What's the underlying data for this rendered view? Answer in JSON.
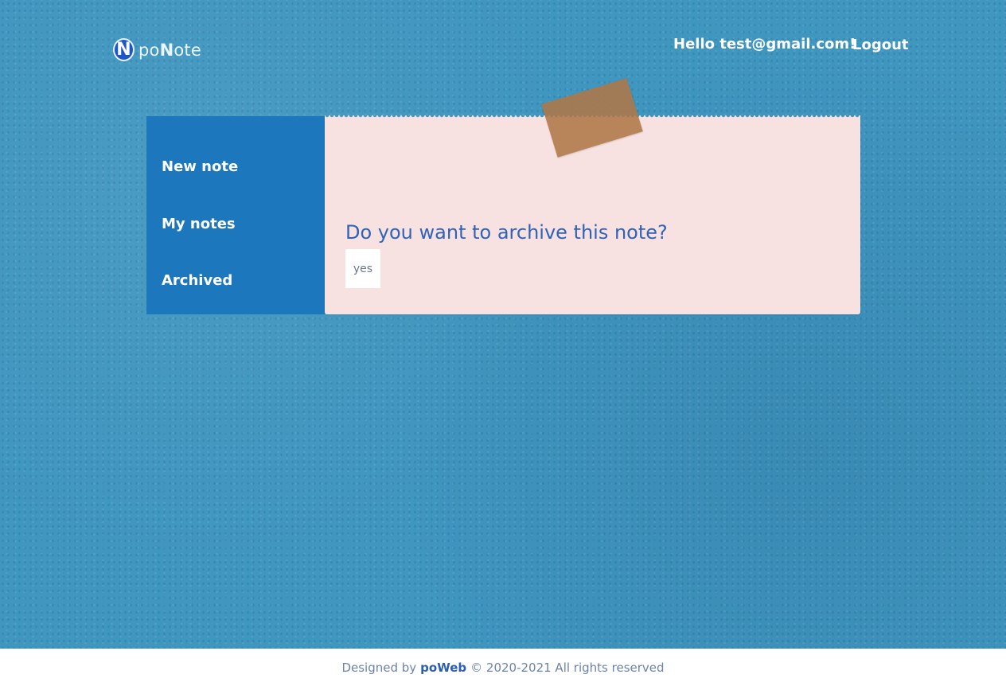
{
  "header": {
    "logo_mark": "N",
    "logo_prefix": "po",
    "logo_bold": "N",
    "logo_suffix": "ote",
    "greeting": "Hello test@gmail.com!",
    "logout_label": "Logout"
  },
  "sidebar": {
    "items": [
      {
        "label": "New note"
      },
      {
        "label": "My notes"
      },
      {
        "label": "Archived"
      }
    ]
  },
  "dialog": {
    "question": "Do you want to archive this note?",
    "confirm_label": "yes"
  },
  "footer": {
    "prefix": "Designed by",
    "brand": "poWeb",
    "suffix": "© 2020-2021 All rights reserved"
  },
  "colors": {
    "background": "#3f96bf",
    "sidebar": "#1d77bd",
    "note_paper": "#f7e2e1",
    "tape": "#af7848",
    "question_text": "#2f63b8",
    "brand": "#2d5fb0"
  }
}
